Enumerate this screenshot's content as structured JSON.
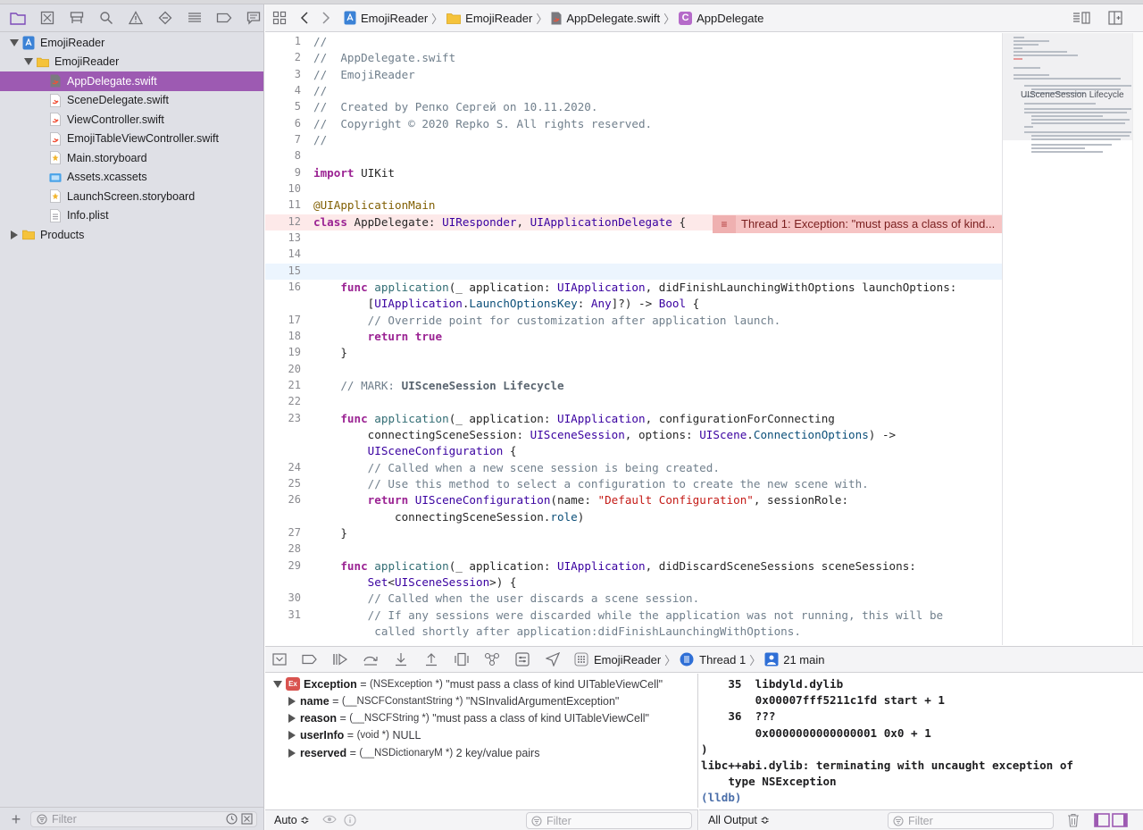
{
  "colors": {
    "accent": "#9d5ab2",
    "error_bg": "#fde9e9",
    "error_badge": "#f6c4c4",
    "current_line": "#ecf5fe",
    "keyword": "#9b2393",
    "string": "#c41a16",
    "comment": "#707f8c"
  },
  "navigator": {
    "tabs": [
      "project-navigator-icon",
      "source-control-icon",
      "symbol-navigator-icon",
      "find-icon",
      "issue-icon",
      "test-icon",
      "debug-icon",
      "breakpoint-icon",
      "report-icon"
    ],
    "tree": [
      {
        "label": "EmojiReader",
        "kind": "project",
        "expanded": true,
        "depth": 0
      },
      {
        "label": "EmojiReader",
        "kind": "folder",
        "expanded": true,
        "depth": 1
      },
      {
        "label": "AppDelegate.swift",
        "kind": "swift",
        "depth": 2,
        "selected": true
      },
      {
        "label": "SceneDelegate.swift",
        "kind": "swift",
        "depth": 2
      },
      {
        "label": "ViewController.swift",
        "kind": "swift",
        "depth": 2
      },
      {
        "label": "EmojiTableViewController.swift",
        "kind": "swift",
        "depth": 2
      },
      {
        "label": "Main.storyboard",
        "kind": "storyboard",
        "depth": 2
      },
      {
        "label": "Assets.xcassets",
        "kind": "assets",
        "depth": 2
      },
      {
        "label": "LaunchScreen.storyboard",
        "kind": "storyboard",
        "depth": 2
      },
      {
        "label": "Info.plist",
        "kind": "plist",
        "depth": 2
      },
      {
        "label": "Products",
        "kind": "folder",
        "expanded": false,
        "depth": 0
      }
    ],
    "filter_placeholder": "Filter"
  },
  "jumpbar": {
    "project": "EmojiReader",
    "group": "EmojiReader",
    "file": "AppDelegate.swift",
    "symbol": "AppDelegate",
    "symbol_badge": "C"
  },
  "editor": {
    "current_line": 15,
    "error_line": 12,
    "error_message": "Thread 1: Exception: \"must pass a class of kind...",
    "lines": [
      {
        "n": "1",
        "t": "//"
      },
      {
        "n": "2",
        "t": "//  AppDelegate.swift"
      },
      {
        "n": "3",
        "t": "//  EmojiReader"
      },
      {
        "n": "4",
        "t": "//"
      },
      {
        "n": "5",
        "t": "//  Created by Репко Сергей on 10.11.2020."
      },
      {
        "n": "6",
        "t": "//  Copyright © 2020 Repko S. All rights reserved."
      },
      {
        "n": "7",
        "t": "//"
      },
      {
        "n": "8",
        "t": ""
      },
      {
        "n": "9",
        "t": "import UIKit"
      },
      {
        "n": "10",
        "t": ""
      },
      {
        "n": "11",
        "t": "@UIApplicationMain"
      },
      {
        "n": "12",
        "t": "class AppDelegate: UIResponder, UIApplicationDelegate {"
      },
      {
        "n": "13",
        "t": ""
      },
      {
        "n": "14",
        "t": ""
      },
      {
        "n": "15",
        "t": ""
      },
      {
        "n": "16",
        "t": "    func application(_ application: UIApplication, didFinishLaunchingWithOptions launchOptions:"
      },
      {
        "n": "",
        "t": "        [UIApplication.LaunchOptionsKey: Any]?) -> Bool {"
      },
      {
        "n": "17",
        "t": "        // Override point for customization after application launch."
      },
      {
        "n": "18",
        "t": "        return true"
      },
      {
        "n": "19",
        "t": "    }"
      },
      {
        "n": "20",
        "t": ""
      },
      {
        "n": "21",
        "t": "    // MARK: UISceneSession Lifecycle"
      },
      {
        "n": "22",
        "t": ""
      },
      {
        "n": "23",
        "t": "    func application(_ application: UIApplication, configurationForConnecting"
      },
      {
        "n": "",
        "t": "        connectingSceneSession: UISceneSession, options: UIScene.ConnectionOptions) ->"
      },
      {
        "n": "",
        "t": "        UISceneConfiguration {"
      },
      {
        "n": "24",
        "t": "        // Called when a new scene session is being created."
      },
      {
        "n": "25",
        "t": "        // Use this method to select a configuration to create the new scene with."
      },
      {
        "n": "26",
        "t": "        return UISceneConfiguration(name: \"Default Configuration\", sessionRole:"
      },
      {
        "n": "",
        "t": "            connectingSceneSession.role)"
      },
      {
        "n": "27",
        "t": "    }"
      },
      {
        "n": "28",
        "t": ""
      },
      {
        "n": "29",
        "t": "    func application(_ application: UIApplication, didDiscardSceneSessions sceneSessions:"
      },
      {
        "n": "",
        "t": "        Set<UISceneSession>) {"
      },
      {
        "n": "30",
        "t": "        // Called when the user discards a scene session."
      },
      {
        "n": "31",
        "t": "        // If any sessions were discarded while the application was not running, this will be"
      },
      {
        "n": "",
        "t": "         called shortly after application:didFinishLaunchingWithOptions."
      }
    ]
  },
  "minimap": {
    "label": "UISceneSession Lifecycle"
  },
  "debug_bar": {
    "target": "EmojiReader",
    "thread": "Thread 1",
    "frame": "21 main"
  },
  "variables": [
    {
      "name": "Exception",
      "type": "(NSException *)",
      "value": "\"must pass a class of kind UITableViewCell\"",
      "expanded": true,
      "depth": 0,
      "badge": "Ex"
    },
    {
      "name": "name",
      "type": "(__NSCFConstantString *)",
      "value": "\"NSInvalidArgumentException\"",
      "depth": 1
    },
    {
      "name": "reason",
      "type": "(__NSCFString *)",
      "value": "\"must pass a class of kind UITableViewCell\"",
      "depth": 1
    },
    {
      "name": "userInfo",
      "type": "(void *)",
      "value": "NULL",
      "depth": 1
    },
    {
      "name": "reserved",
      "type": "(__NSDictionaryM *)",
      "value": "2 key/value pairs",
      "depth": 1
    }
  ],
  "console": {
    "lines": [
      "    35  libdyld.dylib",
      "        0x00007fff5211c1fd start + 1",
      "    36  ???",
      "        0x0000000000000001 0x0 + 1",
      ")",
      "libc++abi.dylib: terminating with uncaught exception of",
      "    type NSException"
    ],
    "prompt": "(lldb)"
  },
  "bottom_left": {
    "scope": "Auto ≎",
    "filter_placeholder": "Filter"
  },
  "bottom_right": {
    "output": "All Output ≎",
    "filter_placeholder": "Filter"
  }
}
